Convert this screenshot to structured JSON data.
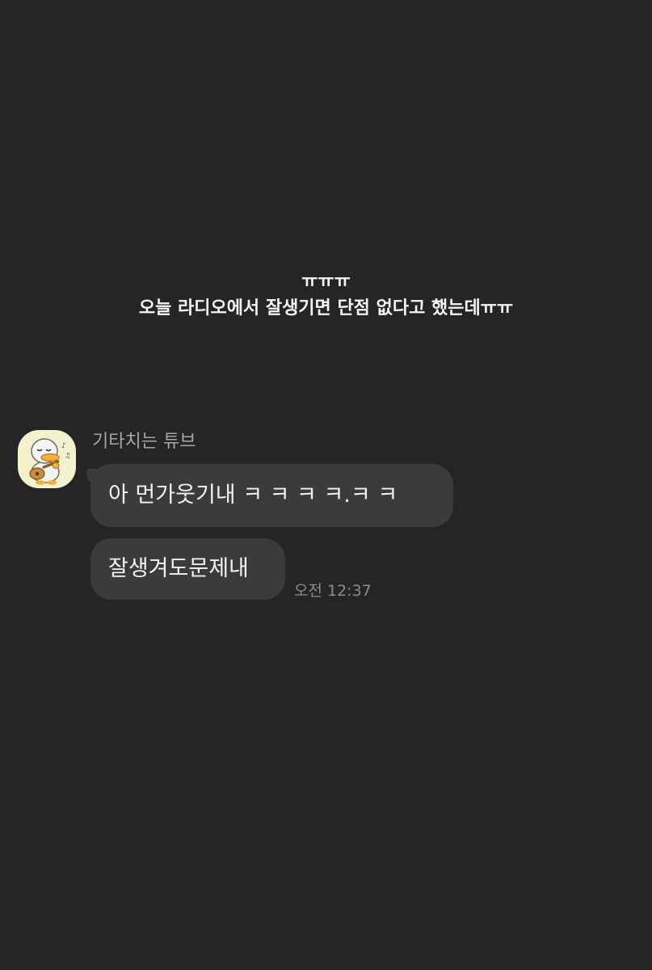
{
  "notice": {
    "line1": "ㅠㅠㅠ",
    "line2": "오늘 라디오에서 잘생기면 단점 없다고 했는데ㅠㅠ"
  },
  "chat": {
    "sender_name": "기타치는 튜브",
    "avatar_icon": "duck-with-guitar-avatar-icon",
    "messages": [
      {
        "text": "아 먼가웃기내 ㅋ ㅋ ㅋ ㅋ.ㅋ ㅋ"
      },
      {
        "text": "잘생겨도문제내"
      }
    ],
    "time": "오전 12:37"
  },
  "colors": {
    "background": "#252527",
    "bubble": "#3b3b3d",
    "sender_text": "#a6a6a8",
    "time_text": "#8c8c8e",
    "avatar_bg": "#f4f1cf"
  }
}
